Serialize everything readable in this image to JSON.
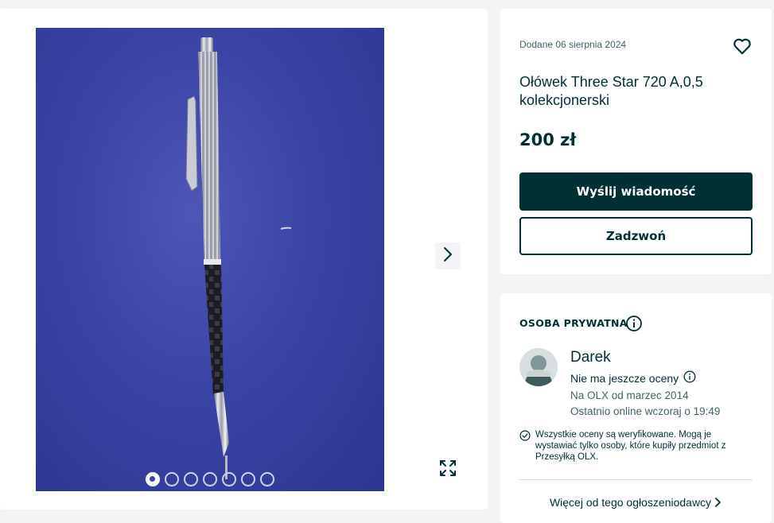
{
  "gallery": {
    "photo_alt": "pencil-photo",
    "image_count": 7,
    "active_index": 0
  },
  "offer": {
    "posted": "Dodane 06 sierpnia 2024",
    "title": "Ołówek Three Star 720 A,0,5 kolekcjonerski",
    "price": "200 zł",
    "message_button": "Wyślij wiadomość",
    "call_button": "Zadzwoń"
  },
  "seller": {
    "type_label": "OSOBA PRYWATNA",
    "name": "Darek",
    "rating": "Nie ma jeszcze oceny",
    "since": "Na OLX od marzec 2014",
    "last_online": "Ostatnio online wczoraj o 19:49",
    "verified_note": "Wszystkie oceny są weryfikowane. Mogą je wystawiać tylko osoby, które kupiły przedmiot z Przesyłką OLX.",
    "more_link": "Więcej od tego ogłoszeniodawcy"
  },
  "colors": {
    "primary": "#002f34",
    "background": "#f2f4f5",
    "muted_text": "#406367"
  }
}
